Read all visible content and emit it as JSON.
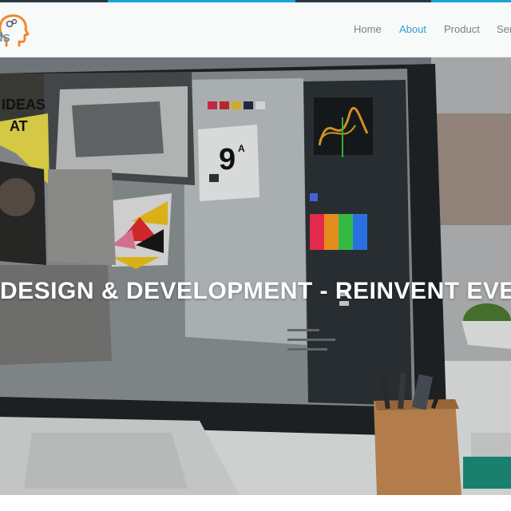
{
  "header": {
    "logo_text": "ds",
    "nav": [
      {
        "label": "Home",
        "active": false
      },
      {
        "label": "About",
        "active": true
      },
      {
        "label": "Product",
        "active": false
      },
      {
        "label": "Ser",
        "active": false
      }
    ]
  },
  "hero": {
    "title": "DESIGN & DEVELOPMENT - REINVENT EVER",
    "poster_text_1": "IDEAS",
    "poster_text_2": "AT",
    "poster_card_text": "9",
    "poster_card_sup": "A"
  },
  "colors": {
    "accent": "#2fa0d5",
    "nav_text": "#7a7f84",
    "logo_orange": "#f08a2c",
    "logo_blue": "#2f86c8",
    "top_strip": "#1aa4d6"
  }
}
